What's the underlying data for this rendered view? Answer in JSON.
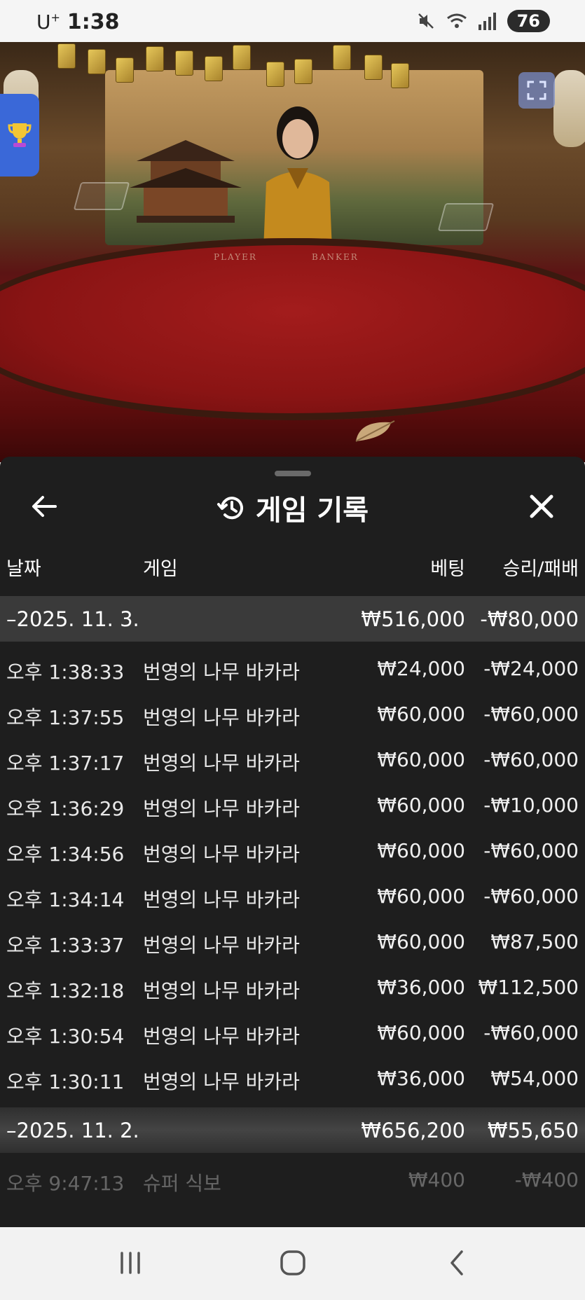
{
  "status_bar": {
    "carrier": "U",
    "carrier_sup": "+",
    "time": "1:38",
    "battery": "76"
  },
  "game_view": {
    "table_labels": {
      "player": "PLAYER",
      "banker": "BANKER"
    },
    "trophy_icon": "trophy-icon",
    "fullscreen_icon": "expand-icon"
  },
  "history_panel": {
    "title": "게임 기록",
    "title_icon": "history-clock-icon",
    "back_icon": "arrow-left-icon",
    "close_icon": "close-icon",
    "columns": {
      "date": "날짜",
      "game": "게임",
      "bet": "베팅",
      "result": "승리/패배"
    },
    "groups": [
      {
        "date": "–2025. 11. 3.",
        "bet_total": "₩516,000",
        "result_total": "-₩80,000",
        "rows": [
          {
            "time": "오후 1:38:33",
            "game": "번영의 나무 바카라",
            "bet": "₩24,000",
            "result": "-₩24,000"
          },
          {
            "time": "오후 1:37:55",
            "game": "번영의 나무 바카라",
            "bet": "₩60,000",
            "result": "-₩60,000"
          },
          {
            "time": "오후 1:37:17",
            "game": "번영의 나무 바카라",
            "bet": "₩60,000",
            "result": "-₩60,000"
          },
          {
            "time": "오후 1:36:29",
            "game": "번영의 나무 바카라",
            "bet": "₩60,000",
            "result": "-₩10,000"
          },
          {
            "time": "오후 1:34:56",
            "game": "번영의 나무 바카라",
            "bet": "₩60,000",
            "result": "-₩60,000"
          },
          {
            "time": "오후 1:34:14",
            "game": "번영의 나무 바카라",
            "bet": "₩60,000",
            "result": "-₩60,000"
          },
          {
            "time": "오후 1:33:37",
            "game": "번영의 나무 바카라",
            "bet": "₩60,000",
            "result": "₩87,500"
          },
          {
            "time": "오후 1:32:18",
            "game": "번영의 나무 바카라",
            "bet": "₩36,000",
            "result": "₩112,500"
          },
          {
            "time": "오후 1:30:54",
            "game": "번영의 나무 바카라",
            "bet": "₩60,000",
            "result": "-₩60,000"
          },
          {
            "time": "오후 1:30:11",
            "game": "번영의 나무 바카라",
            "bet": "₩36,000",
            "result": "₩54,000"
          }
        ]
      },
      {
        "date": "–2025. 11. 2.",
        "bet_total": "₩656,200",
        "result_total": "₩55,650",
        "rows": [
          {
            "time": "오후 9:47:13",
            "game": "슈퍼 식보",
            "bet": "₩400",
            "result": "-₩400"
          }
        ]
      }
    ]
  },
  "nav_bar": {
    "recent_icon": "recent-apps-icon",
    "home_icon": "home-icon",
    "back_icon": "back-chevron-icon"
  },
  "colors": {
    "panel_bg": "#1e1e1e",
    "group_bg": "#3a3a3a",
    "trophy_bg": "#3a68d8",
    "felt": "#8a1414"
  }
}
